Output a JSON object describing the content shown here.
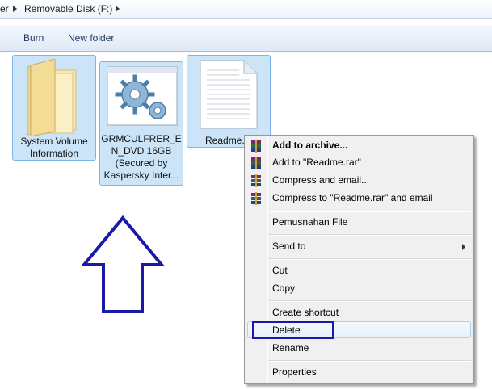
{
  "address": {
    "crumbs": [
      "er",
      "Removable Disk (F:)"
    ]
  },
  "toolbar": {
    "burn_label": "Burn",
    "new_folder_label": "New folder"
  },
  "files": [
    {
      "name_line1": "System Volume",
      "name_line2": "Information",
      "icon": "folder-icon"
    },
    {
      "name_line1": "GRMCULFRER_E",
      "name_line2": "N_DVD 16GB",
      "name_line3": "(Secured by",
      "name_line4": "Kaspersky Inter...",
      "icon": "settings-gear-icon"
    },
    {
      "name_line1": "Readme.t",
      "icon": "text-document-icon"
    }
  ],
  "context_menu": {
    "items": [
      {
        "label": "Add to archive...",
        "bold": true,
        "icon": "winrar-icon"
      },
      {
        "label": "Add to \"Readme.rar\"",
        "icon": "winrar-icon"
      },
      {
        "label": "Compress and email...",
        "icon": "winrar-icon"
      },
      {
        "label": "Compress to \"Readme.rar\" and email",
        "icon": "winrar-icon"
      },
      {
        "label": "Pemusnahan File"
      },
      {
        "label": "Send to",
        "submenu": true
      },
      {
        "label": "Cut"
      },
      {
        "label": "Copy"
      },
      {
        "label": "Create shortcut"
      },
      {
        "label": "Delete"
      },
      {
        "label": "Rename"
      },
      {
        "label": "Properties"
      }
    ]
  },
  "colors": {
    "selection_bg": "#cce4f7",
    "annotation": "#1a1aa6"
  }
}
